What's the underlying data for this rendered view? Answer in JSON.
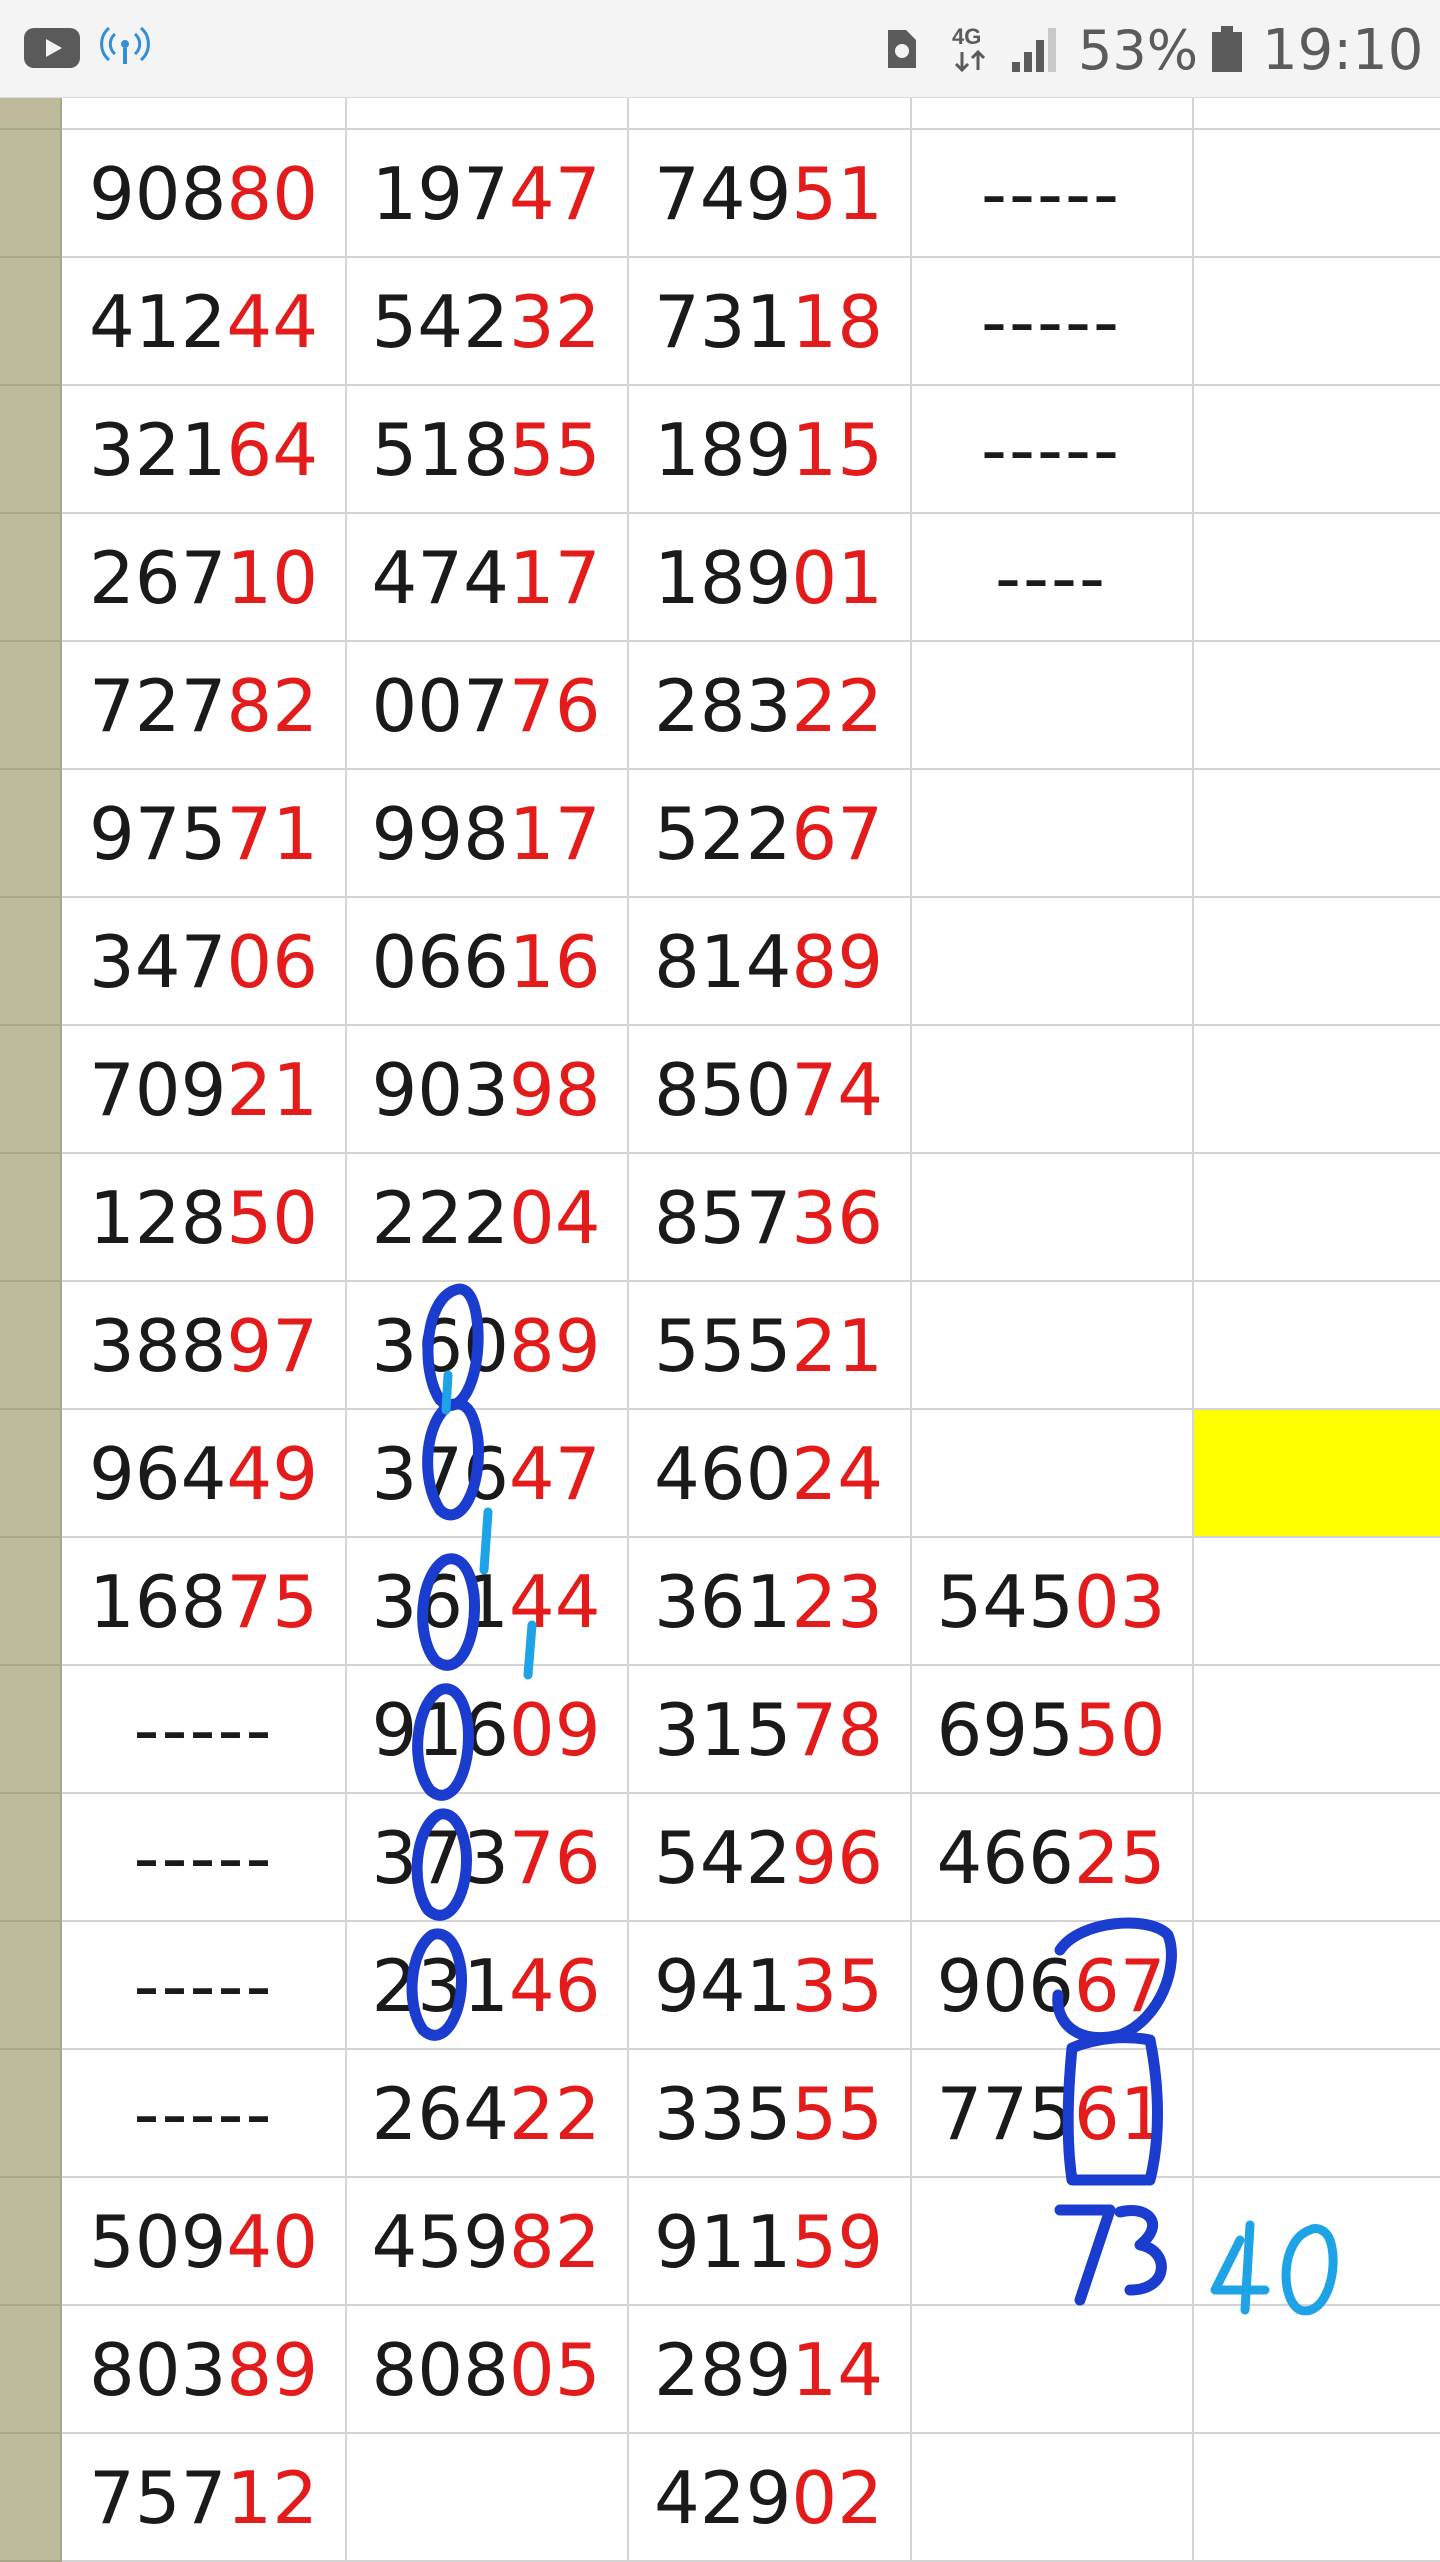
{
  "status_bar": {
    "battery_percent": "53%",
    "time": "19:10",
    "network": "4G",
    "icons": [
      "youtube-icon",
      "hotspot-icon",
      "sim-icon",
      "network-4g-icon",
      "signal-icon",
      "battery-icon"
    ]
  },
  "colors": {
    "highlight_digits": "#e31b1b",
    "row_header": "#bdbb9c",
    "yellow_cell": "#ffff00",
    "ink_dark_blue": "#1a3ccf",
    "ink_light_blue": "#1ea3e6"
  },
  "table": {
    "rows": [
      [
        {
          "pre": "908",
          "hi": "80"
        },
        {
          "pre": "197",
          "hi": "47"
        },
        {
          "pre": "749",
          "hi": "51"
        },
        {
          "dash": "-----"
        }
      ],
      [
        {
          "pre": "412",
          "hi": "44"
        },
        {
          "pre": "542",
          "hi": "32"
        },
        {
          "pre": "731",
          "hi": "18"
        },
        {
          "dash": "-----"
        }
      ],
      [
        {
          "pre": "321",
          "hi": "64"
        },
        {
          "pre": "518",
          "hi": "55"
        },
        {
          "pre": "189",
          "hi": "15"
        },
        {
          "dash": "-----"
        }
      ],
      [
        {
          "pre": "267",
          "hi": "10"
        },
        {
          "pre": "474",
          "hi": "17"
        },
        {
          "pre": "189",
          "hi": "01"
        },
        {
          "dash": "----"
        }
      ],
      [
        {
          "pre": "727",
          "hi": "82"
        },
        {
          "pre": "007",
          "hi": "76"
        },
        {
          "pre": "283",
          "hi": "22"
        },
        {}
      ],
      [
        {
          "pre": "975",
          "hi": "71"
        },
        {
          "pre": "998",
          "hi": "17"
        },
        {
          "pre": "522",
          "hi": "67"
        },
        {}
      ],
      [
        {
          "pre": "347",
          "hi": "06"
        },
        {
          "pre": "066",
          "hi": "16"
        },
        {
          "pre": "814",
          "hi": "89"
        },
        {}
      ],
      [
        {
          "pre": "709",
          "hi": "21"
        },
        {
          "pre": "903",
          "hi": "98"
        },
        {
          "pre": "850",
          "hi": "74"
        },
        {}
      ],
      [
        {
          "pre": "128",
          "hi": "50"
        },
        {
          "pre": "222",
          "hi": "04"
        },
        {
          "pre": "857",
          "hi": "36"
        },
        {}
      ],
      [
        {
          "pre": "388",
          "hi": "97"
        },
        {
          "pre": "360",
          "hi": "89"
        },
        {
          "pre": "555",
          "hi": "21"
        },
        {}
      ],
      [
        {
          "pre": "964",
          "hi": "49"
        },
        {
          "pre": "376",
          "hi": "47"
        },
        {
          "pre": "460",
          "hi": "24"
        },
        {}
      ],
      [
        {
          "pre": "168",
          "hi": "75"
        },
        {
          "pre": "361",
          "hi": "44"
        },
        {
          "pre": "361",
          "hi": "23"
        },
        {
          "pre": "545",
          "hi": "03"
        }
      ],
      [
        {
          "dash": "-----"
        },
        {
          "pre": "916",
          "hi": "09"
        },
        {
          "pre": "315",
          "hi": "78"
        },
        {
          "pre": "695",
          "hi": "50"
        }
      ],
      [
        {
          "dash": "-----"
        },
        {
          "pre": "373",
          "hi": "76"
        },
        {
          "pre": "542",
          "hi": "96"
        },
        {
          "pre": "466",
          "hi": "25"
        }
      ],
      [
        {
          "dash": "-----"
        },
        {
          "pre": "231",
          "hi": "46"
        },
        {
          "pre": "941",
          "hi": "35"
        },
        {
          "pre": "906",
          "hi": "67"
        }
      ],
      [
        {
          "dash": "-----"
        },
        {
          "pre": "264",
          "hi": "22"
        },
        {
          "pre": "335",
          "hi": "55"
        },
        {
          "pre": "775",
          "hi": "61"
        }
      ],
      [
        {
          "pre": "509",
          "hi": "40"
        },
        {
          "pre": "459",
          "hi": "82"
        },
        {
          "pre": "911",
          "hi": "59"
        },
        {}
      ],
      [
        {
          "pre": "803",
          "hi": "89"
        },
        {
          "pre": "808",
          "hi": "05"
        },
        {
          "pre": "289",
          "hi": "14"
        },
        {}
      ],
      [
        {
          "pre": "757",
          "hi": "12"
        },
        {},
        {
          "pre": "429",
          "hi": "02"
        },
        {}
      ]
    ],
    "yellow_cell": {
      "row": 10,
      "col": 5
    }
  },
  "handwriting": {
    "dark_blue_number": "73",
    "light_blue_number": "40"
  }
}
